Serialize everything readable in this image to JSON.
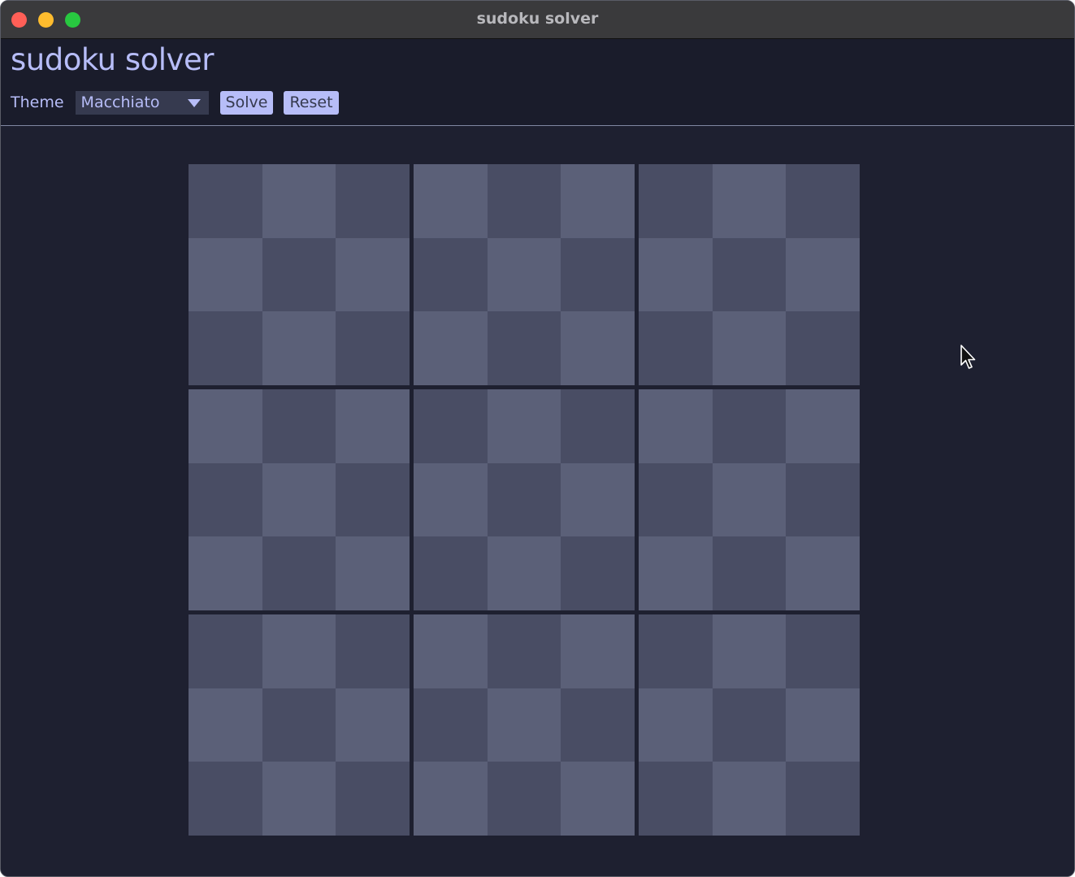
{
  "window": {
    "title": "sudoku solver"
  },
  "header": {
    "app_title": "sudoku solver",
    "theme_label": "Theme",
    "theme_selected": "Macchiato",
    "solve_label": "Solve",
    "reset_label": "Reset"
  },
  "board": {
    "values": [
      [
        "",
        "",
        "",
        "",
        "",
        "",
        "",
        "",
        ""
      ],
      [
        "",
        "",
        "",
        "",
        "",
        "",
        "",
        "",
        ""
      ],
      [
        "",
        "",
        "",
        "",
        "",
        "",
        "",
        "",
        ""
      ],
      [
        "",
        "",
        "",
        "",
        "",
        "",
        "",
        "",
        ""
      ],
      [
        "",
        "",
        "",
        "",
        "",
        "",
        "",
        "",
        ""
      ],
      [
        "",
        "",
        "",
        "",
        "",
        "",
        "",
        "",
        ""
      ],
      [
        "",
        "",
        "",
        "",
        "",
        "",
        "",
        "",
        ""
      ],
      [
        "",
        "",
        "",
        "",
        "",
        "",
        "",
        "",
        ""
      ],
      [
        "",
        "",
        "",
        "",
        "",
        "",
        "",
        "",
        ""
      ]
    ]
  },
  "colors": {
    "background": "#1e2030",
    "accent": "#b7bdf8",
    "cell_light": "#5b6078",
    "cell_dark": "#494d64"
  }
}
